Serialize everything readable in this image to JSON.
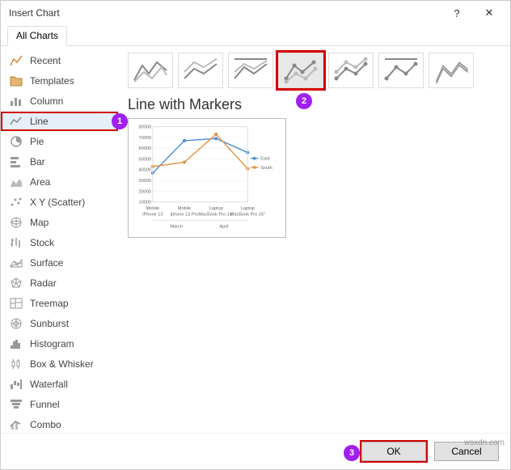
{
  "dialog": {
    "title": "Insert Chart"
  },
  "tabs": {
    "allcharts": "All Charts"
  },
  "sidebar": {
    "items": [
      {
        "label": "Recent"
      },
      {
        "label": "Templates"
      },
      {
        "label": "Column"
      },
      {
        "label": "Line"
      },
      {
        "label": "Pie"
      },
      {
        "label": "Bar"
      },
      {
        "label": "Area"
      },
      {
        "label": "X Y (Scatter)"
      },
      {
        "label": "Map"
      },
      {
        "label": "Stock"
      },
      {
        "label": "Surface"
      },
      {
        "label": "Radar"
      },
      {
        "label": "Treemap"
      },
      {
        "label": "Sunburst"
      },
      {
        "label": "Histogram"
      },
      {
        "label": "Box & Whisker"
      },
      {
        "label": "Waterfall"
      },
      {
        "label": "Funnel"
      },
      {
        "label": "Combo"
      }
    ]
  },
  "main": {
    "subtitle": "Line with Markers"
  },
  "buttons": {
    "ok": "OK",
    "cancel": "Cancel"
  },
  "watermark": "wsxdn.com",
  "badges": {
    "b1": "1",
    "b2": "2",
    "b3": "3"
  },
  "chart_data": {
    "type": "line",
    "title": "",
    "xlabel": "",
    "ylabel": "",
    "ylim": [
      10000,
      80000
    ],
    "yticks": [
      10000,
      20000,
      30000,
      40000,
      50000,
      60000,
      70000,
      80000
    ],
    "categories": [
      "Mobile iPhone 13",
      "Mobile Iphone 13 Pro",
      "Laptop MacBook Pro 14\"",
      "Laptop MacBook Pro 16\""
    ],
    "group_labels": [
      "March",
      "April"
    ],
    "series": [
      {
        "name": "East",
        "color": "#4a8fd6",
        "values": [
          37000,
          67000,
          69000,
          56000
        ]
      },
      {
        "name": "South",
        "color": "#e59243",
        "values": [
          43000,
          47000,
          73000,
          41000
        ]
      }
    ],
    "legend_position": "right"
  }
}
